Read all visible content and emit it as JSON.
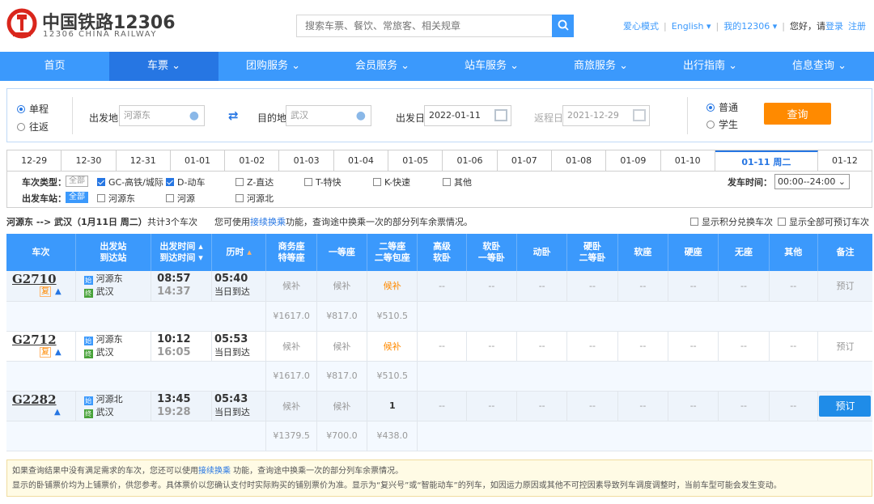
{
  "header": {
    "brand": "中国铁路12306",
    "brand_sub": "12306 CHINA RAILWAY",
    "search_placeholder": "搜索车票、餐饮、常旅客、相关规章",
    "links": [
      "爱心模式",
      "English",
      "我的12306"
    ],
    "greeting": "您好，请",
    "login": "登录",
    "register": "注册",
    "colors": {
      "primary": "#3b99fc",
      "active": "#2676e3",
      "accent": "#ff8a00"
    }
  },
  "nav": [
    "首页",
    "车票",
    "团购服务",
    "会员服务",
    "站车服务",
    "商旅服务",
    "出行指南",
    "信息查询"
  ],
  "query": {
    "trip_types": [
      "单程",
      "往返"
    ],
    "from_label": "出发地",
    "from_value": "河源东",
    "to_label": "目的地",
    "to_value": "武汉",
    "depart_label": "出发日",
    "depart_value": "2022-01-11",
    "return_label": "返程日",
    "return_value": "2021-12-29",
    "passenger_types": [
      "普通",
      "学生"
    ],
    "submit": "查询"
  },
  "dates": [
    "12-29",
    "12-30",
    "12-31",
    "01-01",
    "01-02",
    "01-03",
    "01-04",
    "01-05",
    "01-06",
    "01-07",
    "01-08",
    "01-09",
    "01-10",
    "01-11 周二",
    "01-12"
  ],
  "filters": {
    "type_label": "车次类型：",
    "all": "全部",
    "types": [
      "GC-高铁/城际",
      "D-动车",
      "Z-直达",
      "T-特快",
      "K-快速",
      "其他"
    ],
    "station_label": "出发车站：",
    "stations": [
      "河源东",
      "河源",
      "河源北"
    ],
    "time_label": "发车时间：",
    "time_value": "00:00--24:00"
  },
  "info": {
    "route": "河源东 --> 武汉（1月11日 周二）",
    "count": "共计3个车次",
    "tip_pre": "您可使用",
    "tip_link": "接续换乘",
    "tip_post": "功能，查询途中换乘一次的部分列车余票情况。",
    "opt1": "显示积分兑换车次",
    "opt2": "显示全部可预订车次"
  },
  "columns": {
    "train": "车次",
    "station1": "出发站",
    "station2": "到达站",
    "time1": "出发时间",
    "time2": "到达时间",
    "duration": "历时",
    "biz1": "商务座",
    "biz2": "特等座",
    "first": "一等座",
    "second1": "二等座",
    "second2": "二等包座",
    "hsoft1": "高级",
    "hsoft2": "软卧",
    "soft11": "软卧",
    "soft12": "一等卧",
    "move": "动卧",
    "hard11": "硬卧",
    "hard12": "二等卧",
    "softseat": "软座",
    "hardseat": "硬座",
    "noseat": "无座",
    "other": "其他",
    "remark": "备注"
  },
  "trains": [
    {
      "no": "G2710",
      "fu": "复",
      "from": "河源东",
      "to": "武汉",
      "dep": "08:57",
      "arr": "14:37",
      "dur": "05:40",
      "arrive": "当日到达",
      "biz": "候补",
      "first": "候补",
      "second": "候补",
      "rest": "--",
      "remark": "预订",
      "prices": [
        "¥1617.0",
        "¥817.0",
        "¥510.5"
      ],
      "bookable": false
    },
    {
      "no": "G2712",
      "fu": "复",
      "from": "河源东",
      "to": "武汉",
      "dep": "10:12",
      "arr": "16:05",
      "dur": "05:53",
      "arrive": "当日到达",
      "biz": "候补",
      "first": "候补",
      "second": "候补",
      "rest": "--",
      "remark": "预订",
      "prices": [
        "¥1617.0",
        "¥817.0",
        "¥510.5"
      ],
      "bookable": false
    },
    {
      "no": "G2282",
      "fu": "",
      "from": "河源北",
      "to": "武汉",
      "dep": "13:45",
      "arr": "19:28",
      "dur": "05:43",
      "arrive": "当日到达",
      "biz": "候补",
      "first": "候补",
      "second": "1",
      "rest": "--",
      "remark": "预订",
      "prices": [
        "¥1379.5",
        "¥700.0",
        "¥438.0"
      ],
      "bookable": true
    }
  ],
  "note": {
    "line1_pre": "如果查询结果中没有满足需求的车次，您还可以使用",
    "line1_link": "接续换乘",
    "line1_post": " 功能，查询途中换乘一次的部分列车余票情况。",
    "line2": "显示的卧铺票价均为上铺票价，供您参考。具体票价以您确认支付时实际购买的铺别票价为准。显示为“复兴号”或“智能动车”的列车，如因运力原因或其他不可控因素导致列车调度调整时，当前车型可能会发生变动。"
  }
}
